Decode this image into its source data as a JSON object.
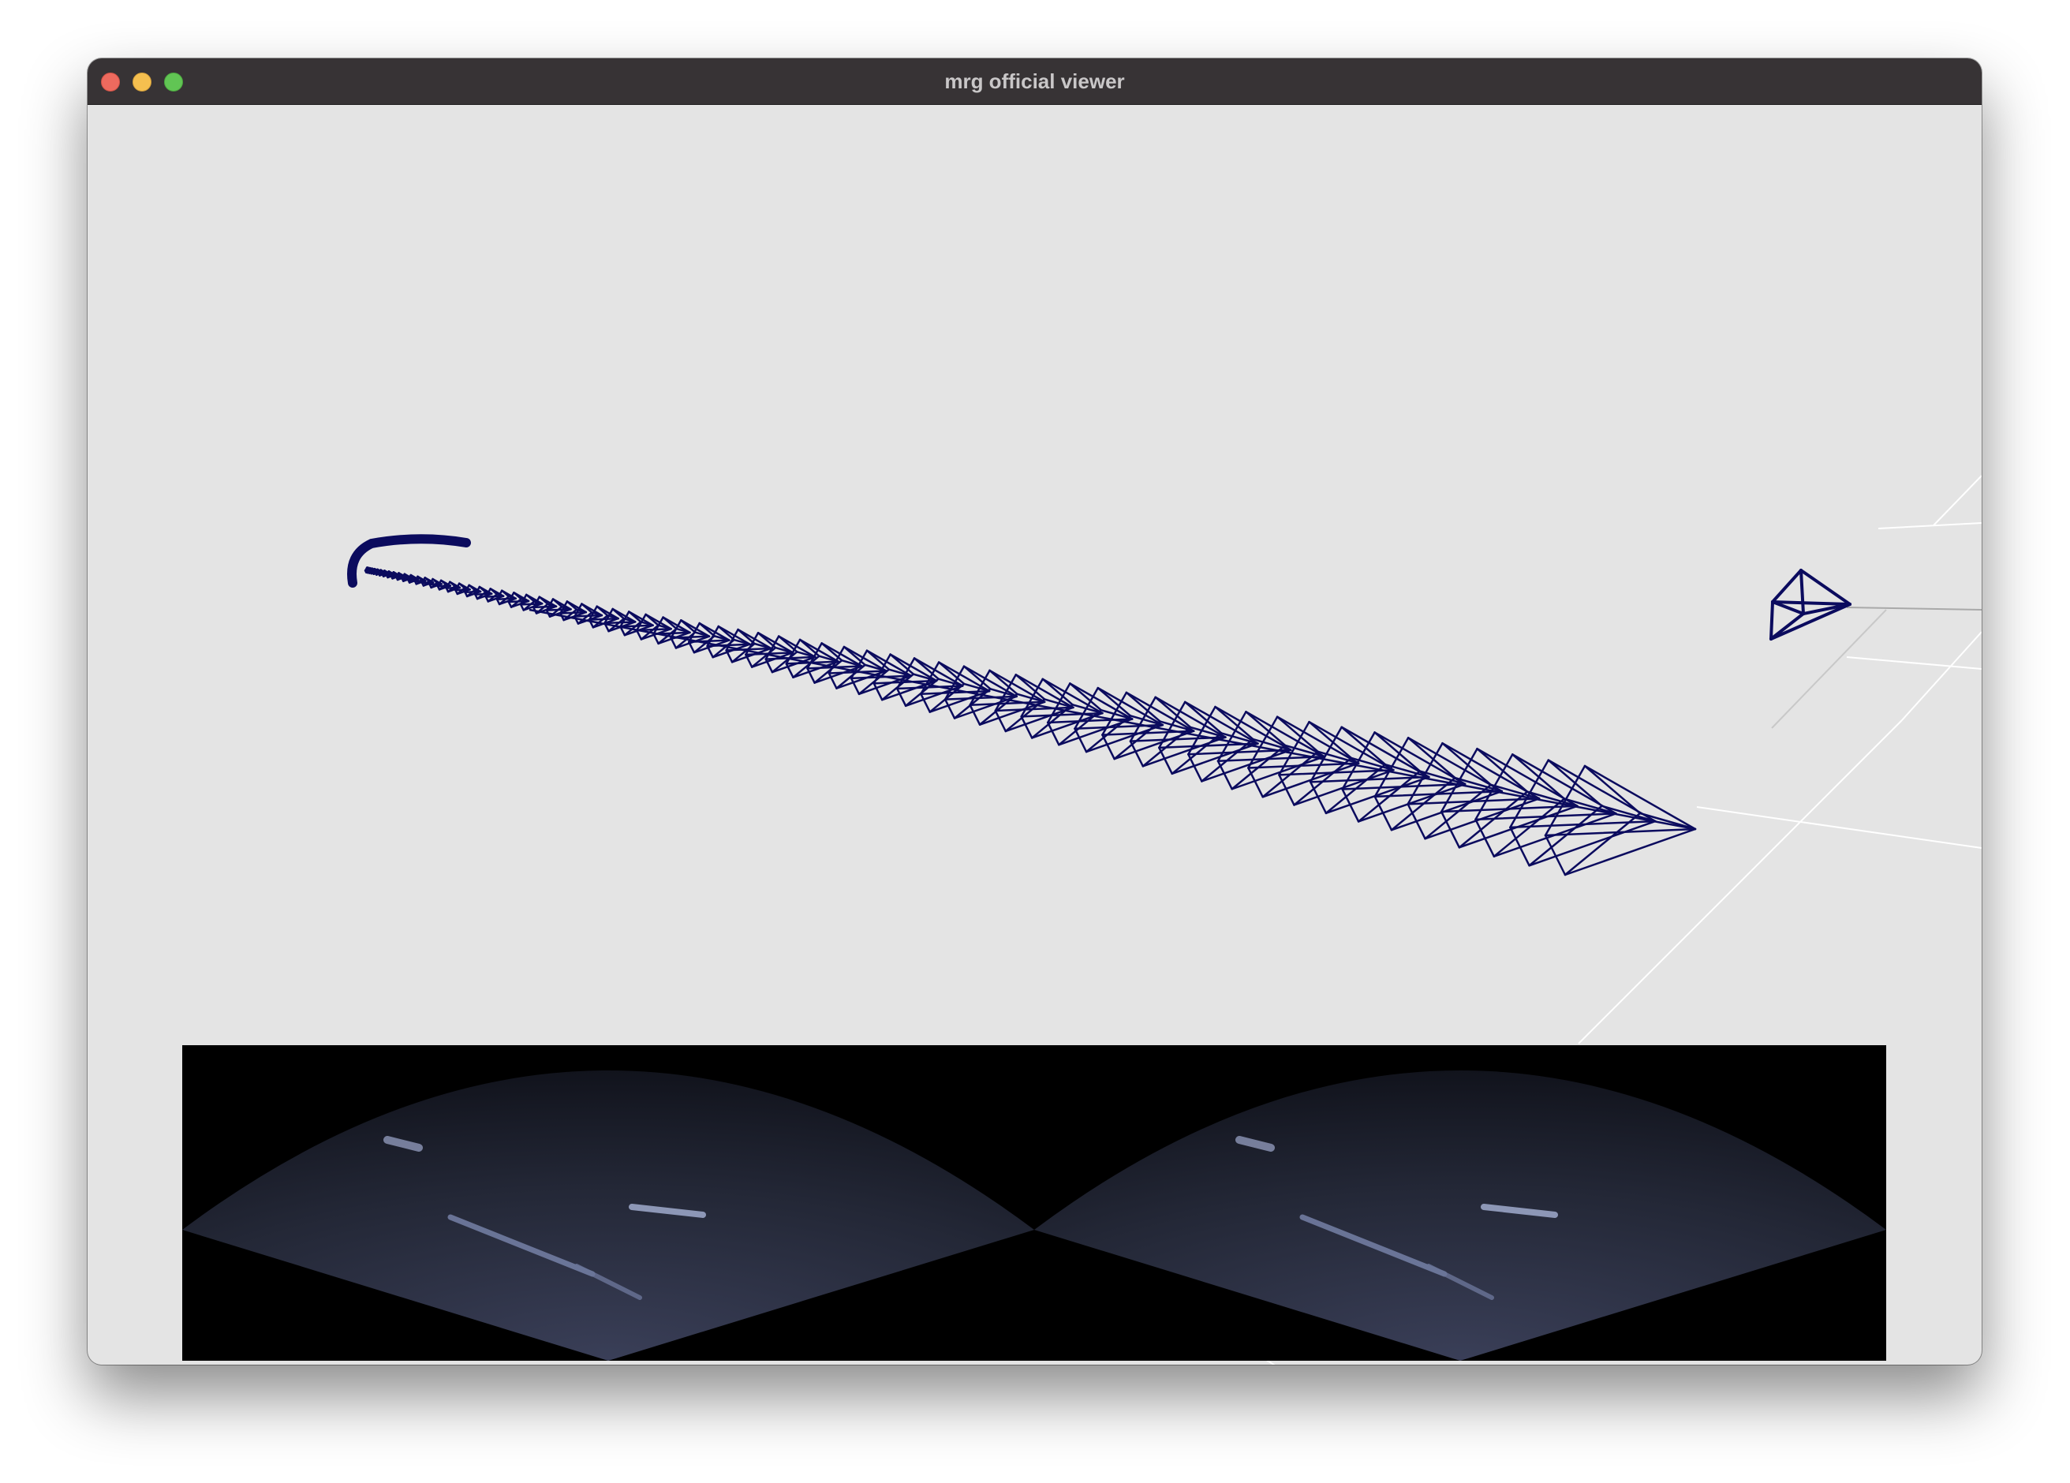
{
  "window": {
    "title": "mrg official viewer"
  },
  "colors": {
    "background": "#e4e4e4",
    "titlebar": "#373335",
    "camera_frustum": "#0b0b5e",
    "grid_lines": "#ffffff",
    "image_panel_bg": "#000000"
  },
  "icons": {
    "close": "close-traffic-light-icon",
    "minimize": "minimize-traffic-light-icon",
    "maximize": "maximize-traffic-light-icon"
  }
}
